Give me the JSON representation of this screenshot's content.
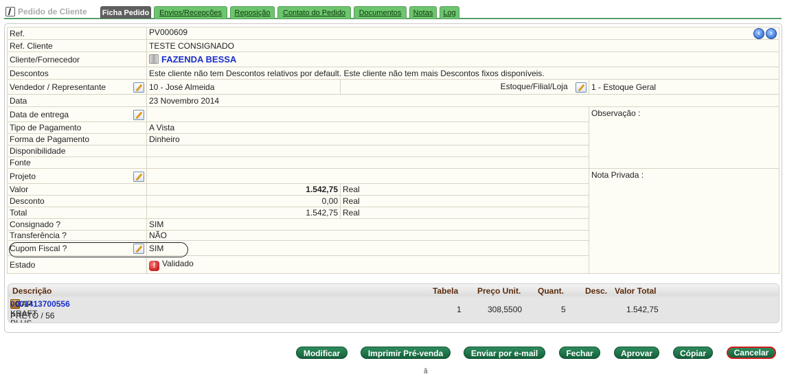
{
  "tabs": {
    "app": "Pedido de Cliente",
    "items": [
      "Ficha Pedido",
      "Envios/Recepções",
      "Reposição",
      "Contato do Pedido",
      "Documentos",
      "Notas",
      "Log"
    ]
  },
  "order": {
    "ref_label": "Ref.",
    "ref_value": "PV000609",
    "ref_cliente_label": "Ref. Cliente",
    "ref_cliente_value": "TESTE CONSIGNADO",
    "cliente_label": "Cliente/Fornecedor",
    "cliente_value": "FAZENDA BESSA",
    "descontos_label": "Descontos",
    "descontos_value": "Este cliente não tem Descontos relativos por default. Este cliente não tem mais Descontos fixos disponíveis.",
    "vendedor_label": "Vendedor / Representante",
    "vendedor_value": "10 - José Almeida",
    "estoque_label": "Estoque/Filial/Loja",
    "estoque_value": "1 - Estoque Geral",
    "data_label": "Data",
    "data_value": "23 Novembro 2014",
    "entrega_label": "Data de entrega",
    "observacao_label": "Observação :",
    "tipo_pag_label": "Tipo de Pagamento",
    "tipo_pag_value": "A Vista",
    "forma_pag_label": "Forma de Pagamento",
    "forma_pag_value": "Dinheiro",
    "disponibilidade_label": "Disponibilidade",
    "fonte_label": "Fonte",
    "projeto_label": "Projeto",
    "nota_privada_label": "Nota Privada :",
    "valor_label": "Valor",
    "valor_value": "1.542,75",
    "currency": "Real",
    "desconto_label": "Desconto",
    "desconto_value": "0,00",
    "total_label": "Total",
    "total_value": "1.542,75",
    "consignado_label": "Consignado ?",
    "consignado_value": "SIM",
    "transferencia_label": "Transferência ?",
    "transferencia_value": "NÃO",
    "cupom_label": "Cupom Fiscal ?",
    "cupom_value": "SIM",
    "estado_label": "Estado",
    "estado_value": "Validado"
  },
  "items": {
    "headers": {
      "descricao": "Descrição",
      "tabela": "Tabela",
      "preco": "Preço Unit.",
      "quant": "Quant.",
      "desc": "Desc.",
      "valor_total": "Valor Total"
    },
    "rows": [
      {
        "code": "0001413700556",
        "name": " - CAP KRAFT PLUS",
        "variant": "PRETO / 56",
        "tabela": "1",
        "preco": "308,5500",
        "quant": "5",
        "valor_total": "1.542,75"
      }
    ]
  },
  "actions": {
    "modificar": "Modificar",
    "imprimir": "Imprimir Pré-venda",
    "enviar": "Enviar por e-mail",
    "fechar": "Fechar",
    "aprovar": "Aprovar",
    "copiar": "Cópiar",
    "cancelar": "Cancelar"
  },
  "footer": {
    "partial_text": "ã"
  }
}
